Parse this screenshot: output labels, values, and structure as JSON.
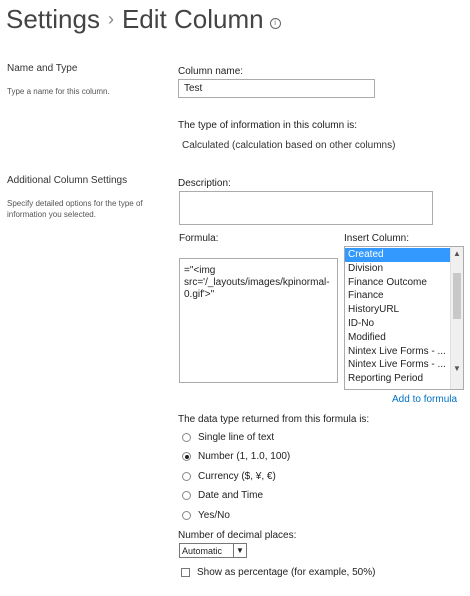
{
  "header": {
    "breadcrumb_root": "Settings",
    "separator": "›",
    "page_title": "Edit Column",
    "info_icon_glyph": "i"
  },
  "name_and_type": {
    "title": "Name and Type",
    "description": "Type a name for this column.",
    "column_name_label": "Column name:",
    "column_name_value": "Test",
    "type_info_label": "The type of information in this column is:",
    "type_value": "Calculated (calculation based on other columns)"
  },
  "additional_settings": {
    "title": "Additional Column Settings",
    "description_line1": "Specify detailed options for the type of",
    "description_line2": "information you selected.",
    "description_label": "Description:",
    "description_value": "",
    "formula_label": "Formula:",
    "formula_value": "=\"<img src='/_layouts/images/kpinormal-0.gif'>\"",
    "insert_column_label": "Insert Column:",
    "insert_column_items": [
      "Created",
      "Division",
      "Finance Outcome",
      "Finance",
      "HistoryURL",
      "ID-No",
      "Modified",
      "Nintex Live Forms - ...",
      "Nintex Live Forms - ...",
      "Reporting Period"
    ],
    "selected_index": 0,
    "add_to_formula_label": "Add to formula",
    "return_type_label": "The data type returned from this formula is:",
    "return_types": [
      {
        "label": "Single line of text",
        "selected": false
      },
      {
        "label": "Number (1, 1.0, 100)",
        "selected": true
      },
      {
        "label": "Currency ($, ¥, €)",
        "selected": false
      },
      {
        "label": "Date and Time",
        "selected": false
      },
      {
        "label": "Yes/No",
        "selected": false
      }
    ],
    "decimal_places_label": "Number of decimal places:",
    "decimal_places_value": "Automatic",
    "show_percentage_label": "Show as percentage (for example, 50%)",
    "show_percentage_checked": false
  },
  "icons": {
    "scroll_up": "▲",
    "scroll_down": "▼",
    "dropdown": "▼"
  }
}
